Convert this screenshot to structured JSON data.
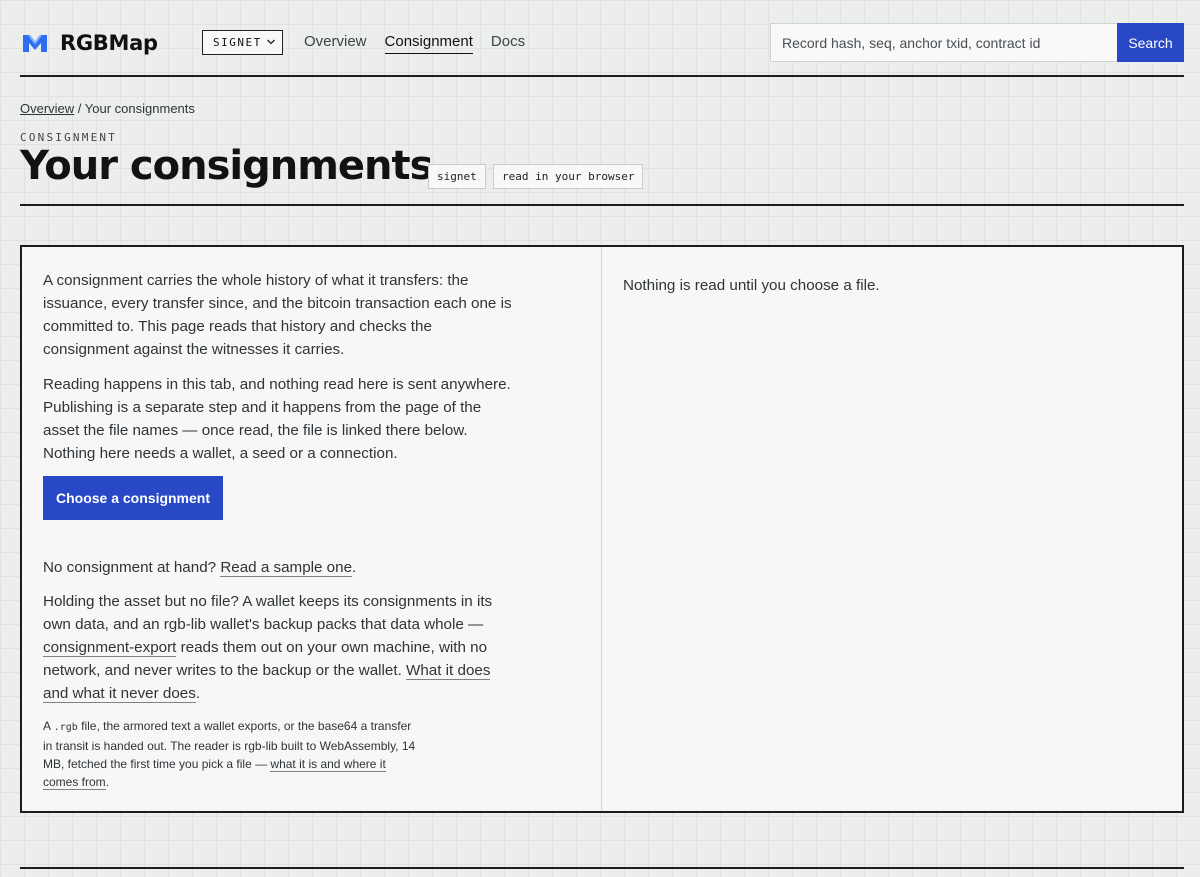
{
  "header": {
    "logo_text": "RGBMap",
    "network": "SIGNET",
    "nav": [
      "Overview",
      "Consignment",
      "Docs"
    ],
    "search_placeholder": "Record hash, seq, anchor txid, contract id",
    "search_button": "Search"
  },
  "breadcrumb": {
    "link": "Overview",
    "sep": " / ",
    "current": "Your consignments"
  },
  "page": {
    "kicker": "CONSIGNMENT",
    "title": "Your consignments",
    "tags": [
      "signet",
      "read in your browser"
    ]
  },
  "left": {
    "p1": "A consignment carries the whole history of what it transfers: the issuance, every transfer since, and the bitcoin transaction each one is committed to. This page reads that history and checks the consignment against the witnesses it carries.",
    "p2": "Reading happens in this tab, and nothing read here is sent anywhere. Publishing is a separate step and it happens from the page of the asset the file names — once read, the file is linked there below. Nothing here needs a wallet, a seed or a connection.",
    "button": "Choose a consignment",
    "p3_pre": "No consignment at hand? ",
    "p3_link": "Read a sample one",
    "p3_post": ".",
    "p4_a": "Holding the asset but no file? A wallet keeps its consignments in its own data, and an rgb-lib wallet's backup packs that data whole — ",
    "p4_link1": "consignment-export",
    "p4_b": " reads them out on your own machine, with no network, and never writes to the backup or the wallet. ",
    "p4_link2": "What it does and what it never does",
    "p4_c": ".",
    "small_a": "A ",
    "small_code": ".rgb",
    "small_b": " file, the armored text a wallet exports, or the base64 a transfer in transit is handed out. The reader is rgb-lib built to WebAssembly, 14 MB, fetched the first time you pick a file — ",
    "small_link": "what it is and where it comes from",
    "small_c": "."
  },
  "right": {
    "status": "Nothing is read until you choose a file."
  },
  "colors": {
    "accent": "#2948c6",
    "ink": "#1c1c1c"
  }
}
